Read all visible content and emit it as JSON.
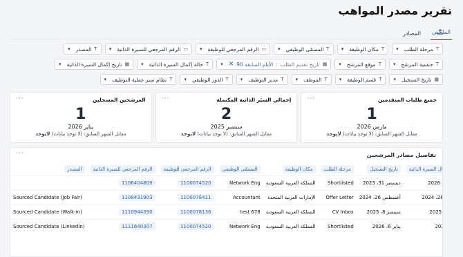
{
  "page": {
    "title": "تقرير مصدر المواهب"
  },
  "tabs": [
    {
      "label": "الملخص",
      "active": true
    },
    {
      "label": "المصادر",
      "active": false
    }
  ],
  "filters": {
    "row1": [
      {
        "icon": "T",
        "label": "مرحلة الطلب"
      },
      {
        "icon": "T",
        "label": "مكان الوظيفة"
      },
      {
        "icon": "T",
        "label": "المسمّى الوظيفي"
      },
      {
        "icon": "▭",
        "label": "الرقم المرجعي للوظيفة"
      },
      {
        "icon": "▭",
        "label": "الرقم المرجعي للسيرة الذاتية"
      },
      {
        "icon": "T",
        "label": "المصدر"
      }
    ],
    "row2": [
      {
        "icon": "T",
        "label": "جنسية المرشح"
      },
      {
        "icon": "T",
        "label": "موقع المرشح"
      },
      {
        "icon": "▦",
        "label": "تاريخ تقديم الطلب",
        "range_value": "الأيام السابقة 90",
        "clearable": true
      },
      {
        "icon": "T",
        "label": "حالة إكمال السيرة الذاتية"
      },
      {
        "icon": "▦",
        "label": "تاريخ إكمال السيرة الذاتية"
      },
      {
        "icon": "▦",
        "label": "تاريخ التسجيل"
      }
    ],
    "row3": [
      {
        "icon": "T",
        "label": "قسم الوظيفة"
      },
      {
        "icon": "T",
        "label": "الموظف"
      },
      {
        "icon": "T",
        "label": "مدير التوظيف"
      },
      {
        "icon": "T",
        "label": "الدور الوظيفي"
      },
      {
        "icon": "T",
        "label": "نظام سير عملية التوظيف"
      }
    ]
  },
  "kpis": [
    {
      "title": "جميع طلبات المتقدمين",
      "value": "1",
      "date": "مارس 2026",
      "sub_prefix": "مقابل الشهر السابق: (لا توجد بيانات)",
      "sub_bold": "لايوجد"
    },
    {
      "title": "إجمالي السيَر الذاتية المكتملة",
      "value": "2",
      "date": "سبتمبر 2025",
      "sub_prefix": "مقابل الشهر السابق: (لا توجد بيانات)",
      "sub_bold": "لايوجد"
    },
    {
      "title": "المرشحين المسجلين",
      "value": "1",
      "date": "يناير 2026",
      "sub_prefix": "مقابل الشهر السابق: (لا توجد بيانات)",
      "sub_bold": "لايوجد"
    }
  ],
  "kpi_menu": "···",
  "table": {
    "title": "تفاصيل مصادر المرشحين",
    "menu": "···",
    "headers": [
      "تاريخ إكمال السيرة الذاتية",
      "تاريخ التسجيل",
      "مرحلة الطلب",
      "مكان الوظيفة",
      "المسمّى الوظيفي",
      "الرقم المرجعي للوظيفة",
      "الرقم المرجعي للسيرة الذاتية",
      "المصدر"
    ],
    "rows": [
      [
        "مارس 10، 2026",
        "ديسمبر 31، 2023",
        "Shortlisted",
        "المملكة العربية السعودية",
        "Network Eng",
        "1100074520",
        "1106404809",
        ""
      ],
      [
        "أغسطس 26، 2024",
        "أغسطس 26، 2024",
        "Offer Letter",
        "الإمارات العربية المتحدة",
        "Accountant",
        "1100078411",
        "1108431903",
        "Sourced Candidate (Job Fair)"
      ],
      [
        "سبتمبر 8، 2025",
        "سبتمبر 8، 2025",
        "CV Inbox",
        "المملكة العربية السعودية",
        "test 678",
        "1100078136",
        "1110944390",
        "Sourced Candidate (Walk-in)"
      ],
      [
        "يناير 6، 2026",
        "يناير 6، 2026",
        "Shortlisted",
        "المملكة العربية السعودية",
        "Network Eng",
        "1100074520",
        "1111640307",
        "Sourced Candidate (LinkedIn)"
      ]
    ]
  }
}
